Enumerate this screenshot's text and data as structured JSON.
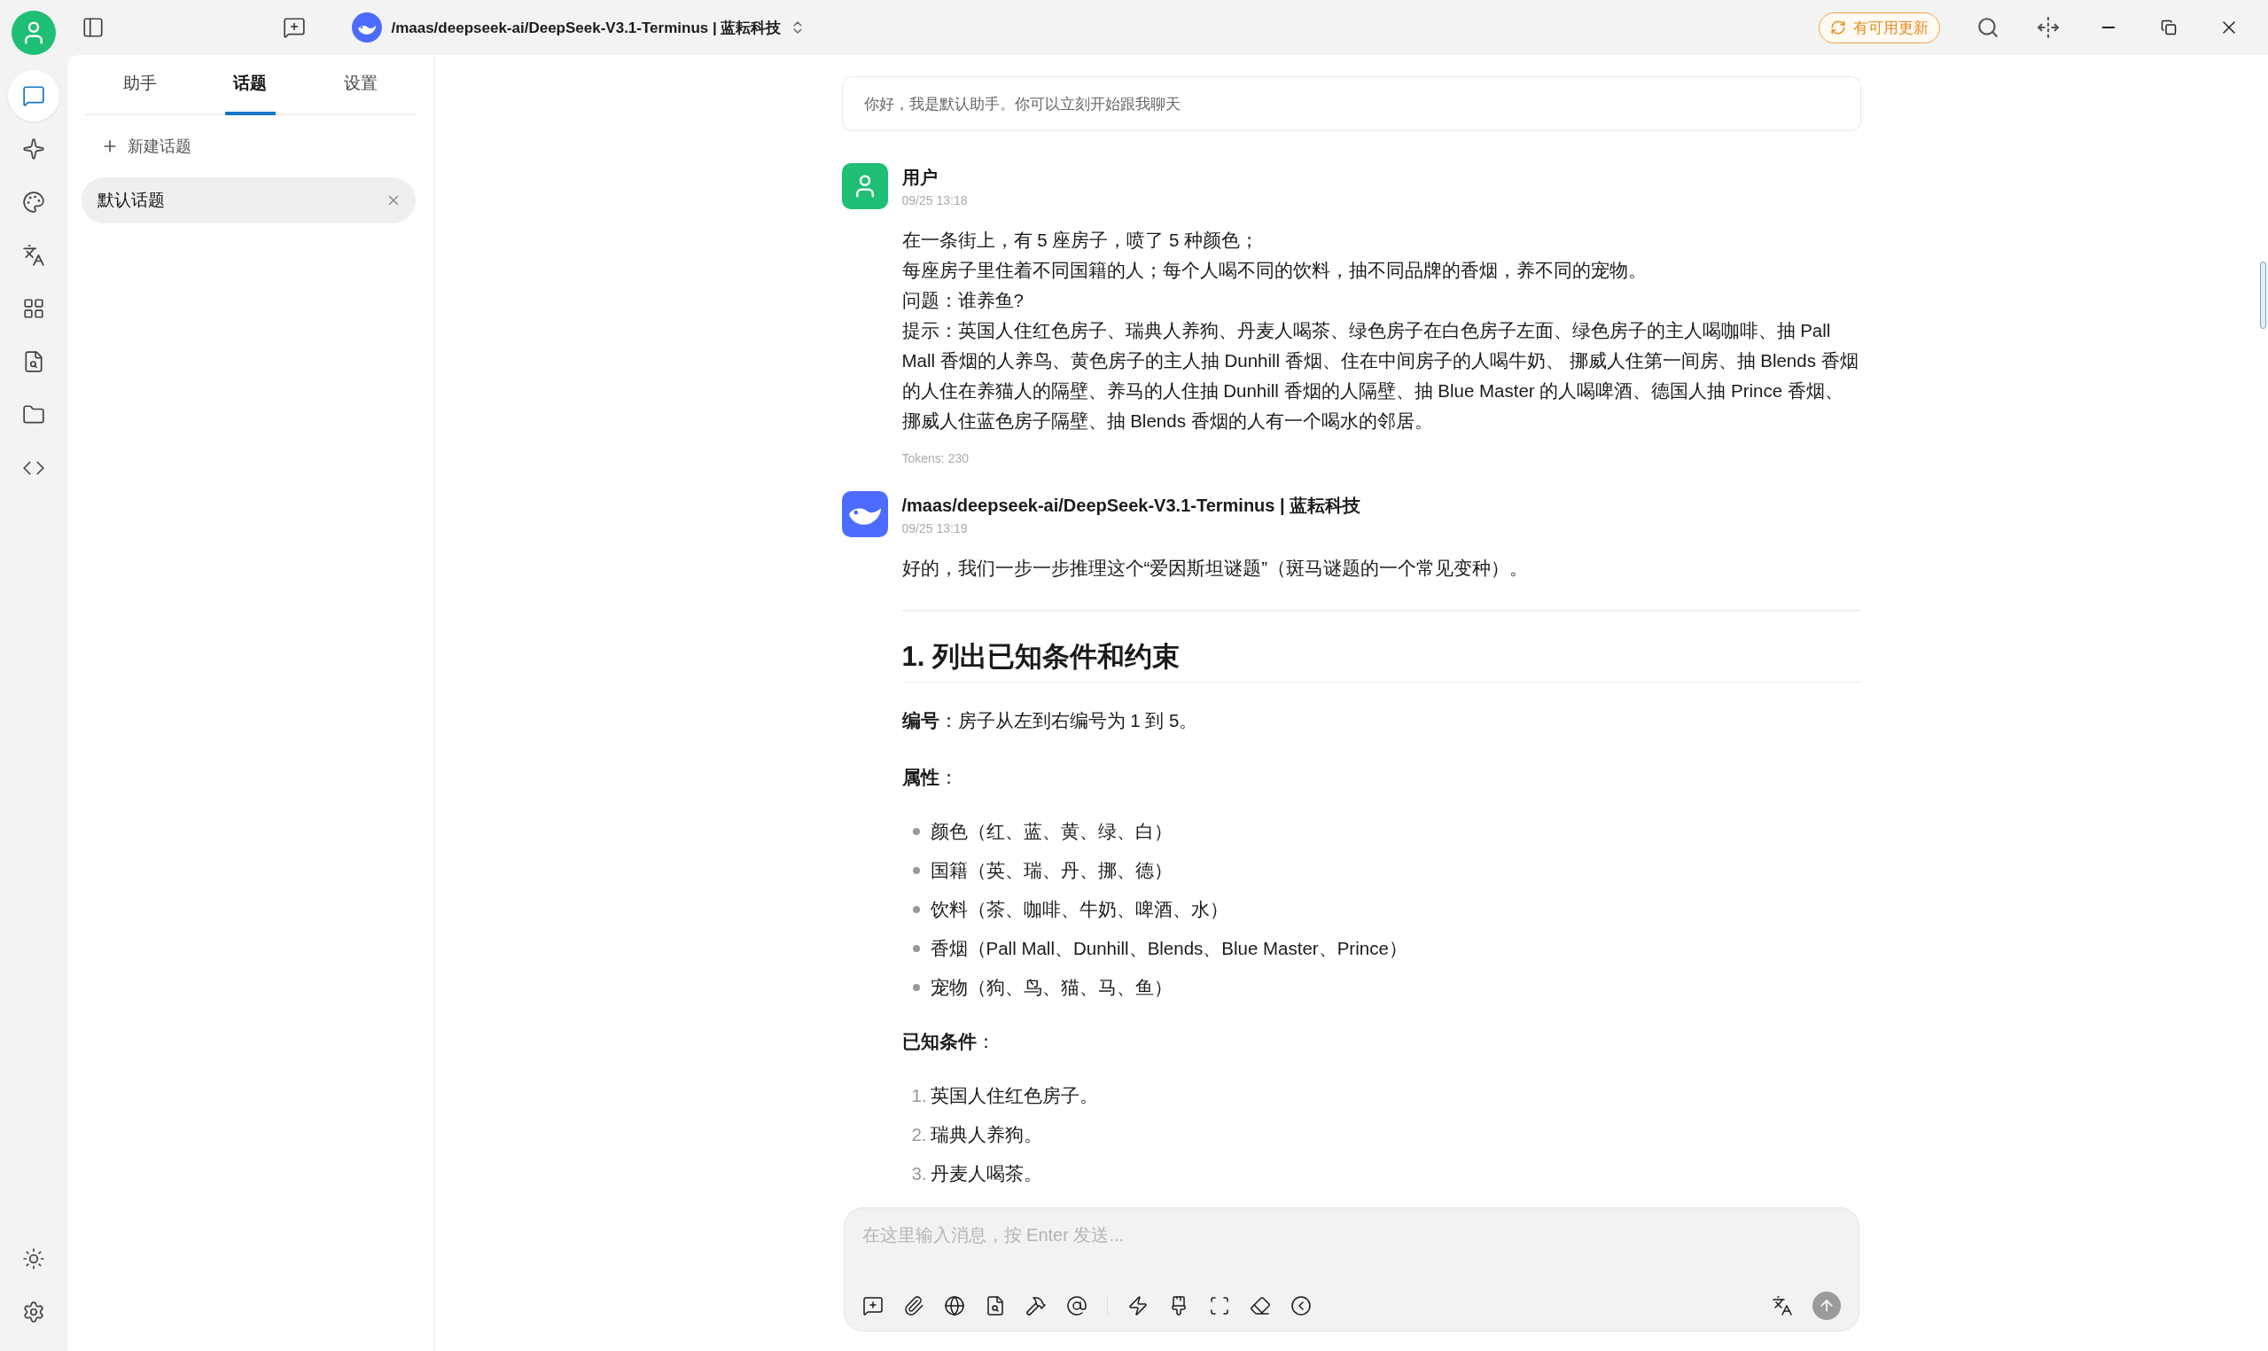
{
  "titlebar": {
    "model_name": "/maas/deepseek-ai/DeepSeek-V3.1-Terminus | 蓝耘科技",
    "update_badge": "有可用更新"
  },
  "rail": [
    {
      "kind": "chat",
      "selected": true
    },
    {
      "kind": "sparkle",
      "selected": false
    },
    {
      "kind": "palette",
      "selected": false
    },
    {
      "kind": "translate",
      "selected": false
    },
    {
      "kind": "apps",
      "selected": false
    },
    {
      "kind": "file-search",
      "selected": false
    },
    {
      "kind": "folder",
      "selected": false
    },
    {
      "kind": "code",
      "selected": false
    }
  ],
  "sidebar": {
    "tabs": [
      {
        "label": "助手",
        "selected": false
      },
      {
        "label": "话题",
        "selected": true
      },
      {
        "label": "设置",
        "selected": false
      }
    ],
    "new_topic": "新建话题",
    "topics": [
      {
        "label": "默认话题",
        "selected": true
      }
    ]
  },
  "greeting": "你好，我是默认助手。你可以立刻开始跟我聊天",
  "messages": [
    {
      "kind": "user",
      "name": "用户",
      "time": "09/25 13:18",
      "tokens": "Tokens: 230",
      "blocks": [
        {
          "kind": "lines",
          "lines": [
            "在一条街上，有 5 座房子，喷了 5 种颜色；",
            "每座房子里住着不同国籍的人；每个人喝不同的饮料，抽不同品牌的香烟，养不同的宠物。",
            "问题：谁养鱼?",
            "提示：英国人住红色房子、瑞典人养狗、丹麦人喝茶、绿色房子在白色房子左面、绿色房子的主人喝咖啡、抽 Pall Mall 香烟的人养鸟、黄色房子的主人抽 Dunhill 香烟、住在中间房子的人喝牛奶、 挪威人住第一间房、抽 Blends 香烟的人住在养猫人的隔壁、养马的人住抽 Dunhill 香烟的人隔壁、抽 Blue Master 的人喝啤酒、德国人抽 Prince 香烟、挪威人住蓝色房子隔壁、抽 Blends 香烟的人有一个喝水的邻居。"
          ]
        }
      ]
    },
    {
      "kind": "assistant",
      "name": "/maas/deepseek-ai/DeepSeek-V3.1-Terminus | 蓝耘科技",
      "time": "09/25 13:19",
      "blocks": [
        {
          "kind": "paragraph",
          "text": "好的，我们一步一步推理这个“爱因斯坦谜题”（斑马谜题的一个常见变种）。"
        },
        {
          "kind": "rule"
        },
        {
          "kind": "heading",
          "text": "1. 列出已知条件和约束"
        },
        {
          "kind": "paragraph",
          "text": "**编号**：房子从左到右编号为 1 到 5。"
        },
        {
          "kind": "paragraph",
          "text": "**属性**："
        },
        {
          "kind": "bullets",
          "items": [
            "颜色（红、蓝、黄、绿、白）",
            "国籍（英、瑞、丹、挪、德）",
            "饮料（茶、咖啡、牛奶、啤酒、水）",
            "香烟（Pall Mall、Dunhill、Blends、Blue Master、Prince）",
            "宠物（狗、鸟、猫、马、鱼）"
          ]
        },
        {
          "kind": "paragraph",
          "text": "**已知条件**："
        },
        {
          "kind": "ordered",
          "items": [
            {
              "number": "1.",
              "text": "英国人住红色房子。"
            },
            {
              "number": "2.",
              "text": "瑞典人养狗。"
            },
            {
              "number": "3.",
              "text": "丹麦人喝茶。"
            }
          ]
        }
      ]
    }
  ],
  "input": {
    "placeholder": "在这里输入消息，按 Enter 发送..."
  }
}
